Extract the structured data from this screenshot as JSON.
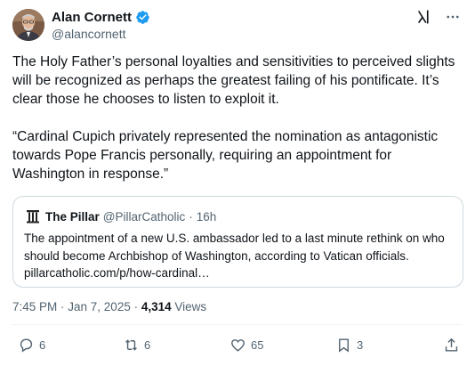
{
  "tweet": {
    "author": {
      "display_name": "Alan Cornett",
      "handle": "@alancornett",
      "verified": true,
      "avatar_icon": "profile-photo"
    },
    "paragraphs": [
      "The Holy Father’s personal loyalties and sensitivities to perceived slights will be recognized as perhaps the greatest failing of his pontificate. It’s clear those he chooses to listen to exploit it.",
      "“Cardinal Cupich privately represented the nomination as antagonistic towards Pope Francis personally, requiring an appointment for Washington in response.”"
    ],
    "quoted": {
      "display_name": "The Pillar",
      "handle": "@PillarCatholic",
      "separator": "·",
      "age": "16h",
      "text": "The appointment of a new U.S. ambassador led to a last minute rethink on who should become Archbishop of Washington, according to Vatican officials. pillarcatholic.com/p/how-cardinal…"
    },
    "timestamp": "7:45 PM · Jan 7, 2025 · ",
    "views_count": "4,314",
    "views_label": " Views",
    "actions": {
      "replies": "6",
      "reposts": "6",
      "likes": "65",
      "bookmarks": "3"
    }
  },
  "colors": {
    "accent": "#1d9bf0",
    "text_primary": "#0f1419",
    "text_secondary": "#536471",
    "border": "#cfd9de"
  }
}
